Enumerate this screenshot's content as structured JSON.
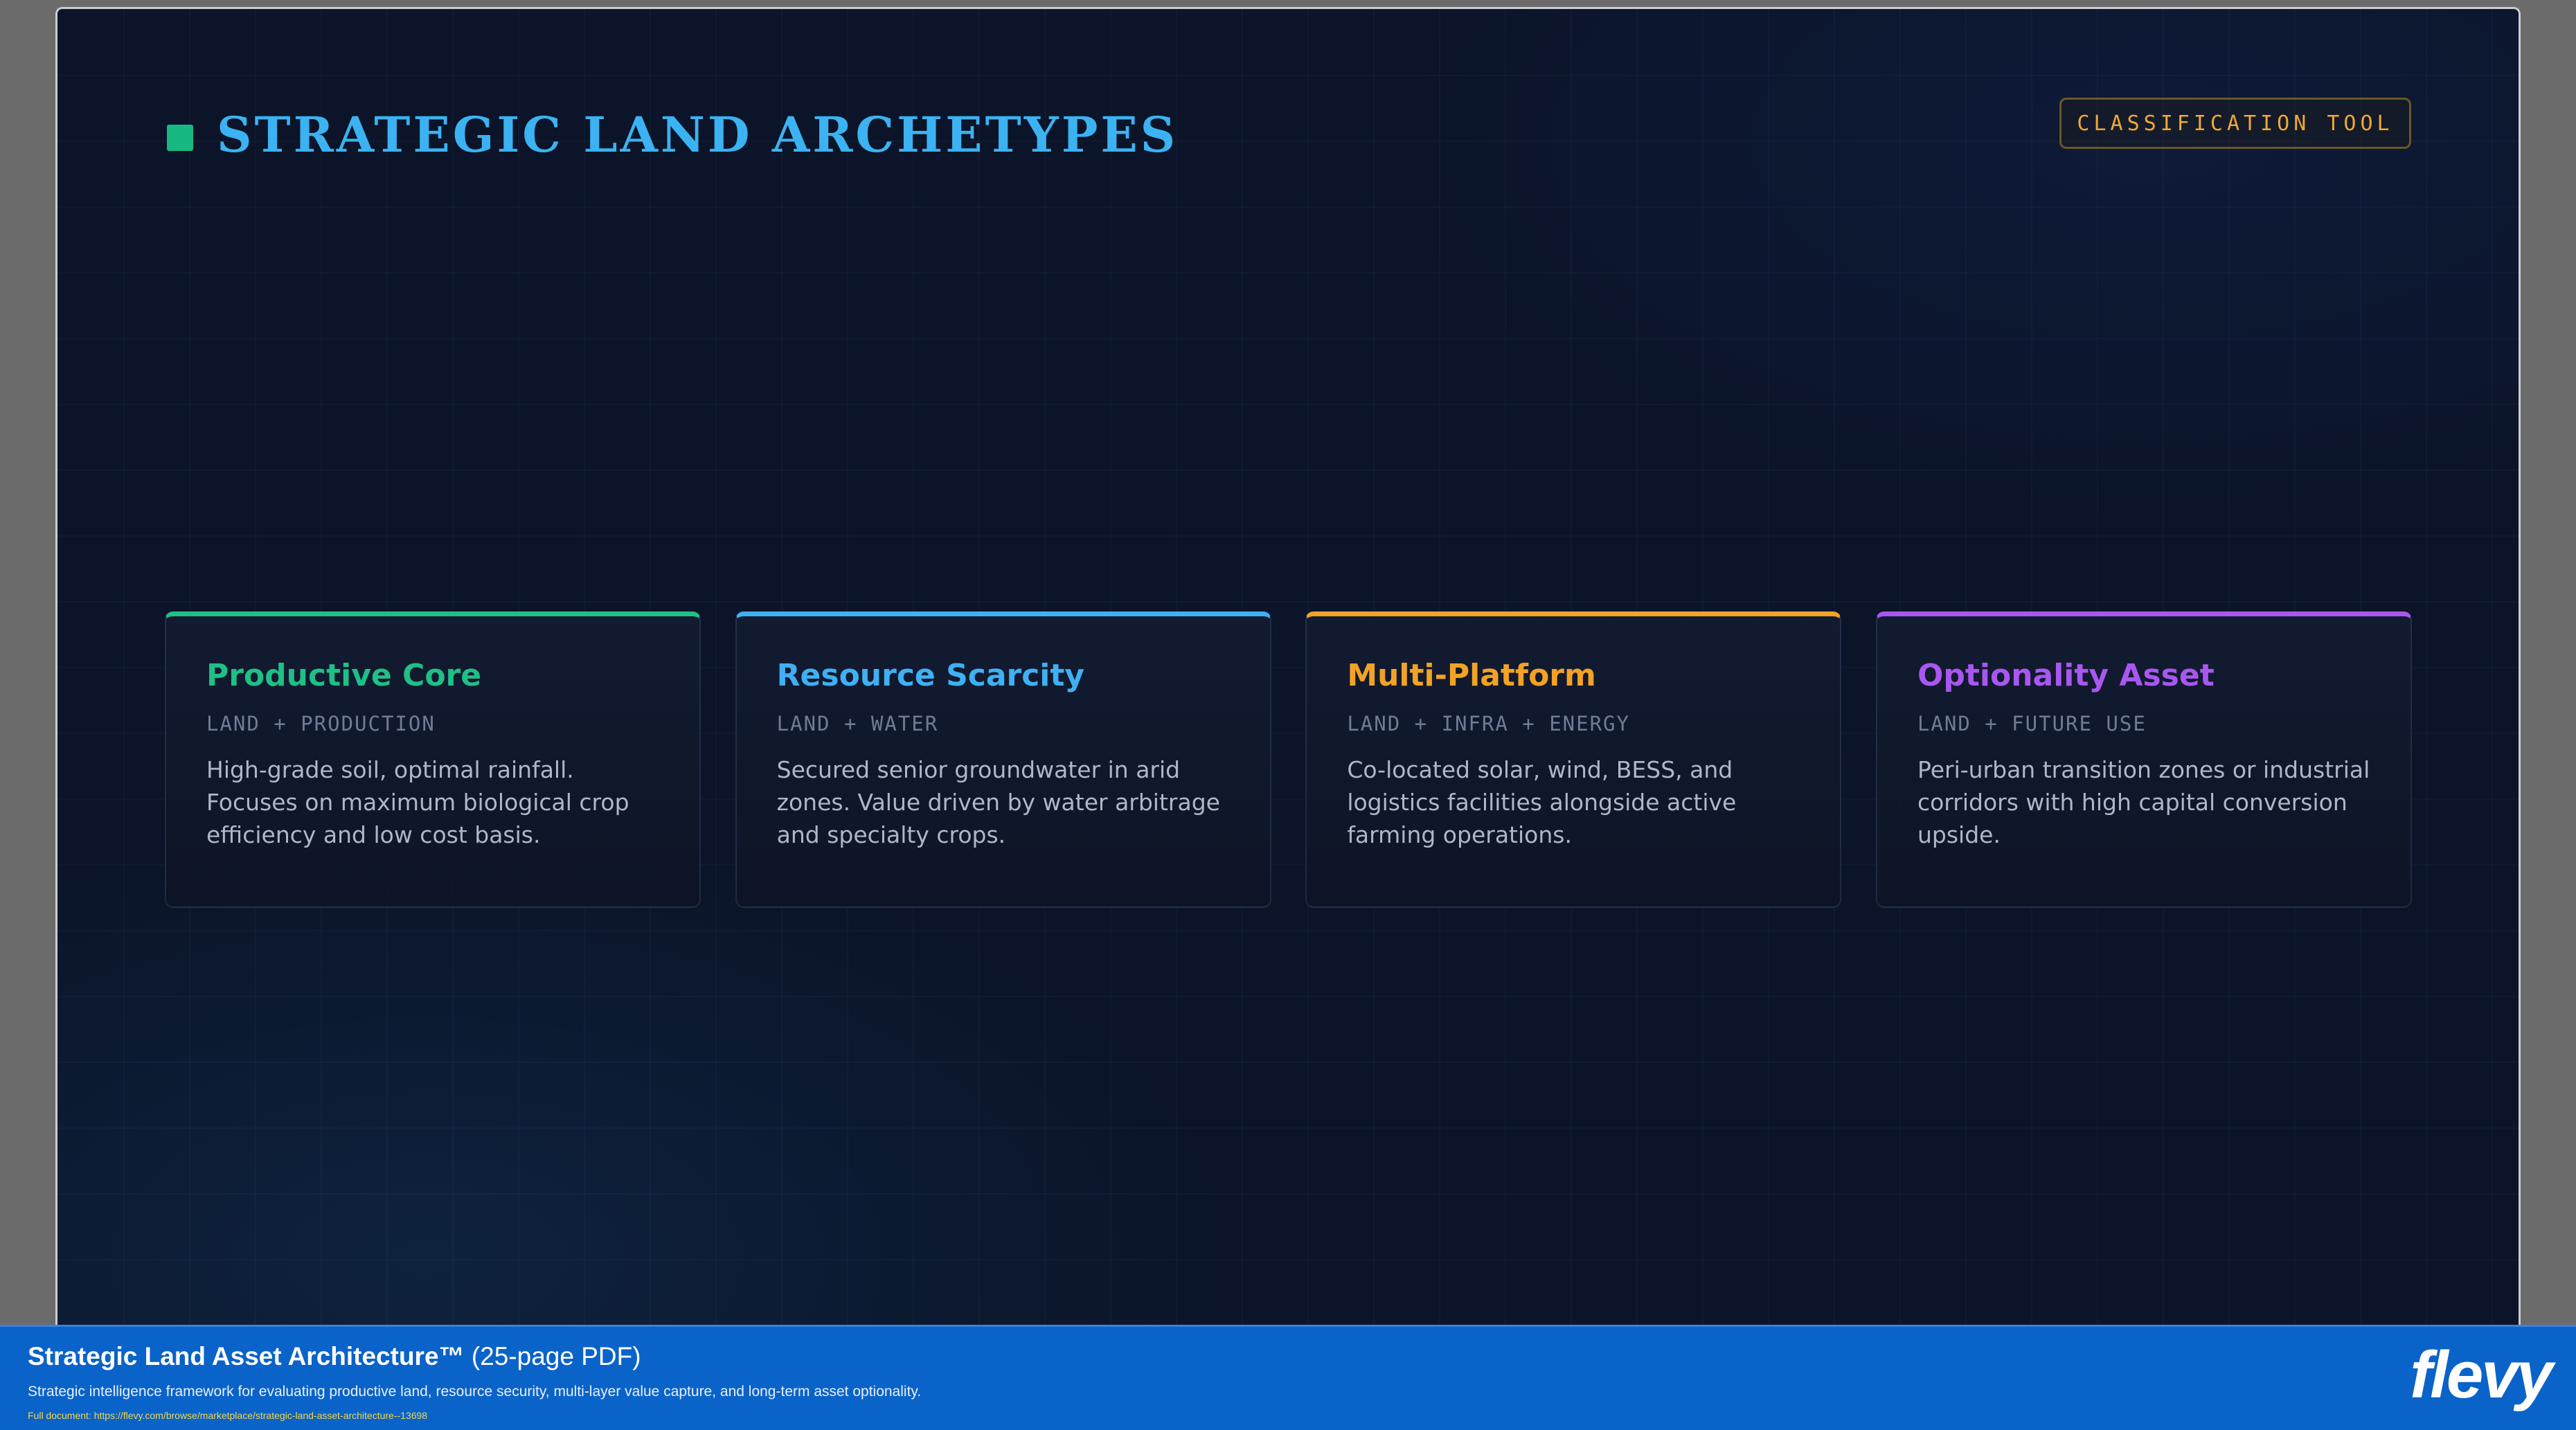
{
  "slide": {
    "title": "STRATEGIC LAND ARCHETYPES",
    "badge": "CLASSIFICATION TOOL"
  },
  "cards": [
    {
      "title": "Productive Core",
      "tag": "LAND + PRODUCTION",
      "body": "High-grade soil, optimal rainfall. Focuses on maximum biological crop efficiency and low cost basis.",
      "accent": "#1fbf86"
    },
    {
      "title": "Resource Scarcity",
      "tag": "LAND + WATER",
      "body": "Secured senior groundwater in arid zones. Value driven by water arbitrage and specialty crops.",
      "accent": "#3fb0f4"
    },
    {
      "title": "Multi-Platform",
      "tag": "LAND + INFRA + ENERGY",
      "body": "Co-located solar, wind, BESS, and logistics facilities alongside active farming operations.",
      "accent": "#f2a224"
    },
    {
      "title": "Optionality Asset",
      "tag": "LAND + FUTURE USE",
      "body": "Peri-urban transition zones or industrial corridors with high capital conversion upside.",
      "accent": "#a857f0"
    }
  ],
  "banner": {
    "title": "Strategic Land Asset Architecture™",
    "pages": "(25-page PDF)",
    "description": "Strategic intelligence framework for evaluating productive land, resource security, multi-layer value capture, and long-term asset optionality.",
    "link": "Full document: https://flevy.com/browse/marketplace/strategic-land-asset-architecture--13698",
    "logo": "flevy"
  },
  "colors": {
    "title_square": "#18b883",
    "title_text": "#3bb2f1",
    "badge_text": "#f0a832",
    "banner_bg": "#0a63c9"
  }
}
